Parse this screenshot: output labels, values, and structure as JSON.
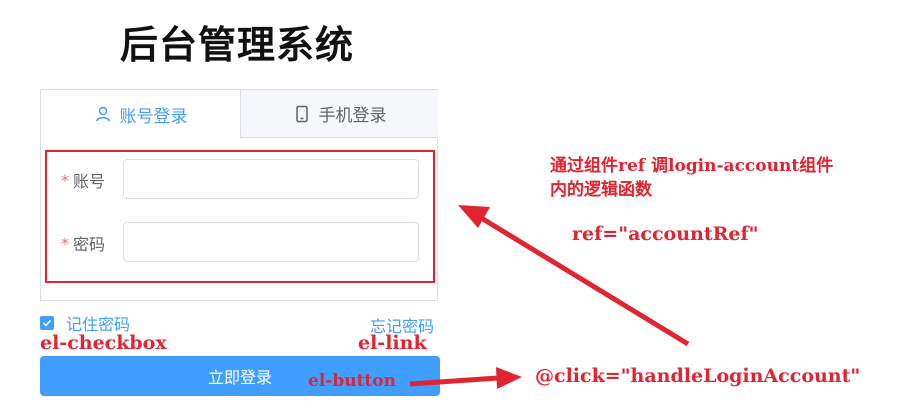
{
  "page": {
    "title": "后台管理系统"
  },
  "tabs": [
    {
      "label": "账号登录",
      "icon": "user-icon",
      "active": true
    },
    {
      "label": "手机登录",
      "icon": "phone-icon",
      "active": false
    }
  ],
  "form": {
    "fields": [
      {
        "required_mark": "*",
        "label": "账号",
        "value": "",
        "placeholder": ""
      },
      {
        "required_mark": "*",
        "label": "密码",
        "value": "",
        "placeholder": ""
      }
    ]
  },
  "remember": {
    "label": "记住密码",
    "checked": true
  },
  "forgot": {
    "label": "忘记密码"
  },
  "login_button": {
    "label": "立即登录"
  },
  "component_tags": {
    "checkbox": "el-checkbox",
    "link": "el-link",
    "button": "el-button"
  },
  "annotations": {
    "ref_note_line1": "通过组件ref 调login-account组件",
    "ref_note_line2": "内的逻辑函数",
    "ref_code": "ref=\"accountRef\"",
    "click_code": "@click=\"handleLoginAccount\""
  },
  "colors": {
    "primary": "#409eff",
    "annotation_red": "#e02431",
    "required_star": "#f56c6c"
  }
}
